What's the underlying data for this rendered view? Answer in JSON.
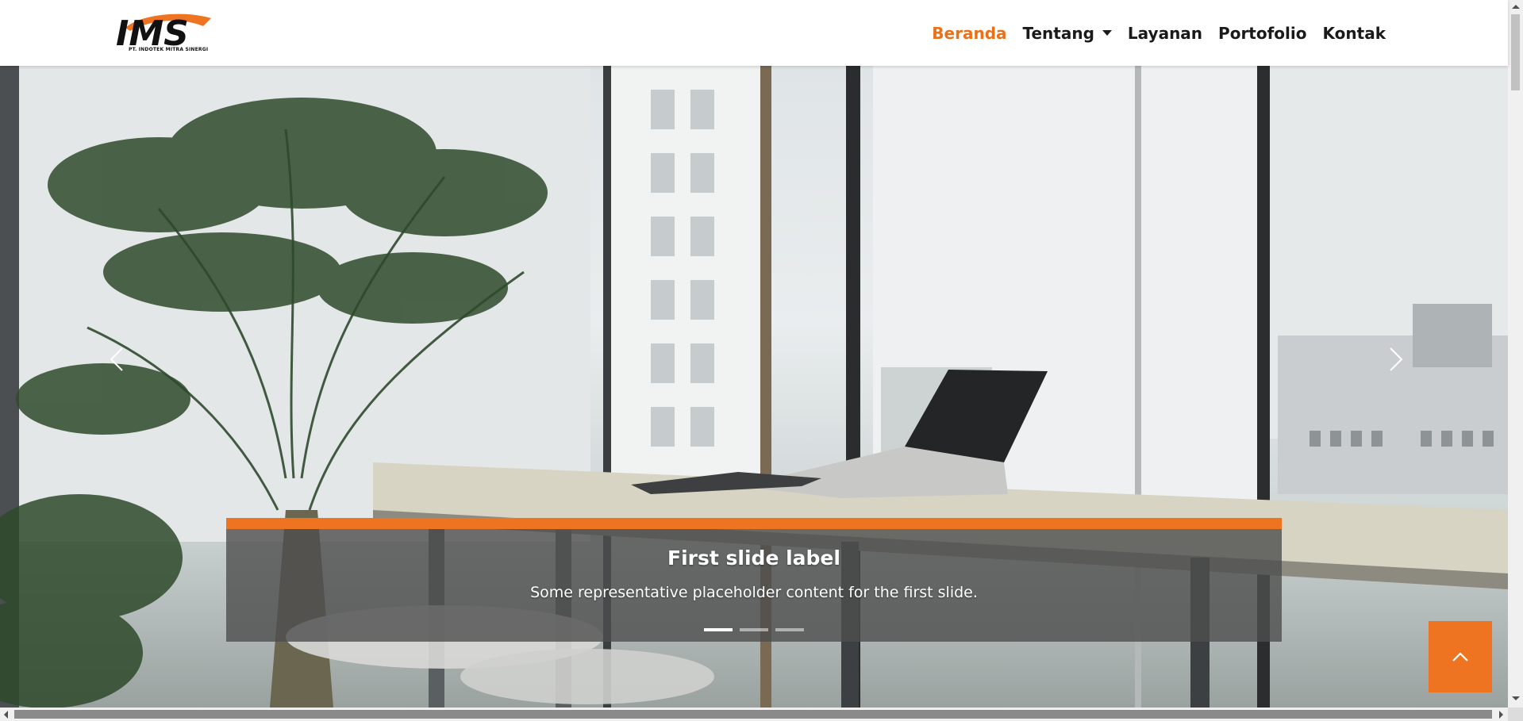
{
  "brand": {
    "logo_text": "IMS",
    "company_name": "PT. INDOTEK MITRA SINERGI",
    "accent_color": "#ee7422"
  },
  "nav": {
    "items": [
      {
        "label": "Beranda",
        "active": true
      },
      {
        "label": "Tentang",
        "dropdown": true
      },
      {
        "label": "Layanan"
      },
      {
        "label": "Portofolio"
      },
      {
        "label": "Kontak"
      }
    ]
  },
  "carousel": {
    "prev_icon": "chevron-left-icon",
    "next_icon": "chevron-right-icon",
    "active_slide": 1,
    "slide_count": 3,
    "caption": {
      "title": "First slide label",
      "text": "Some representative placeholder content for the first slide."
    }
  },
  "back_to_top": {
    "icon": "chevron-up-icon"
  }
}
